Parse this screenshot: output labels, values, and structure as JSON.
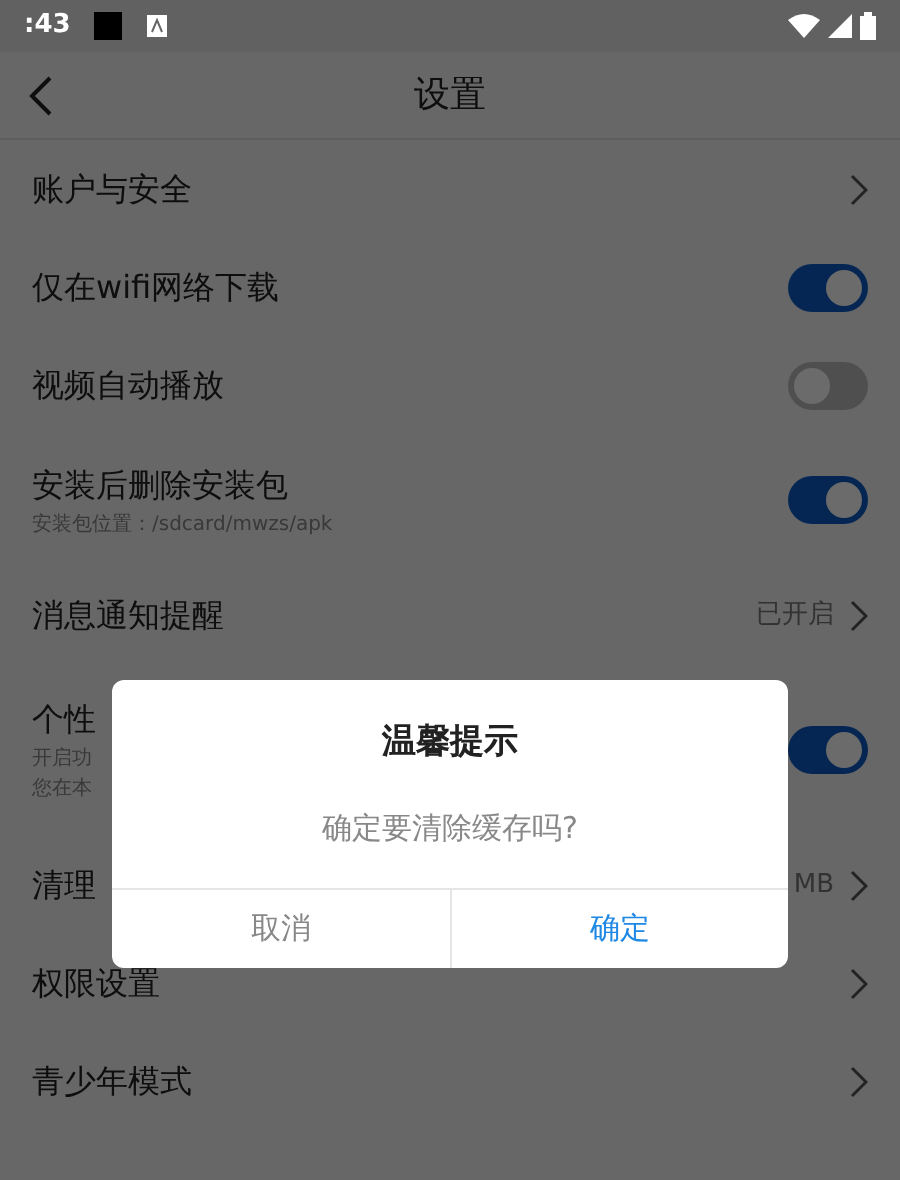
{
  "status_bar": {
    "time": ":43"
  },
  "header": {
    "title": "设置"
  },
  "rows": [
    {
      "kind": "link",
      "label": "账户与安全"
    },
    {
      "kind": "toggle",
      "label": "仅在wifi网络下载",
      "on": true
    },
    {
      "kind": "toggle",
      "label": "视频自动播放",
      "on": false
    },
    {
      "kind": "toggle",
      "label": "安装后删除安装包",
      "sublabels": [
        "安装包位置：/sdcard/mwzs/apk"
      ],
      "on": true
    },
    {
      "kind": "link",
      "label": "消息通知提醒",
      "value": "已开启"
    },
    {
      "kind": "toggle",
      "label": "个性",
      "sublabels": [
        "开启功",
        "您在本"
      ],
      "on": true
    },
    {
      "kind": "link",
      "label": "清理",
      "value": "MB"
    },
    {
      "kind": "link",
      "label": "权限设置"
    },
    {
      "kind": "link",
      "label": "青少年模式"
    }
  ],
  "dialog": {
    "title": "温馨提示",
    "message": "确定要清除缓存吗?",
    "buttons": [
      {
        "label": "取消",
        "primary": false
      },
      {
        "label": "确定",
        "primary": true
      }
    ]
  }
}
